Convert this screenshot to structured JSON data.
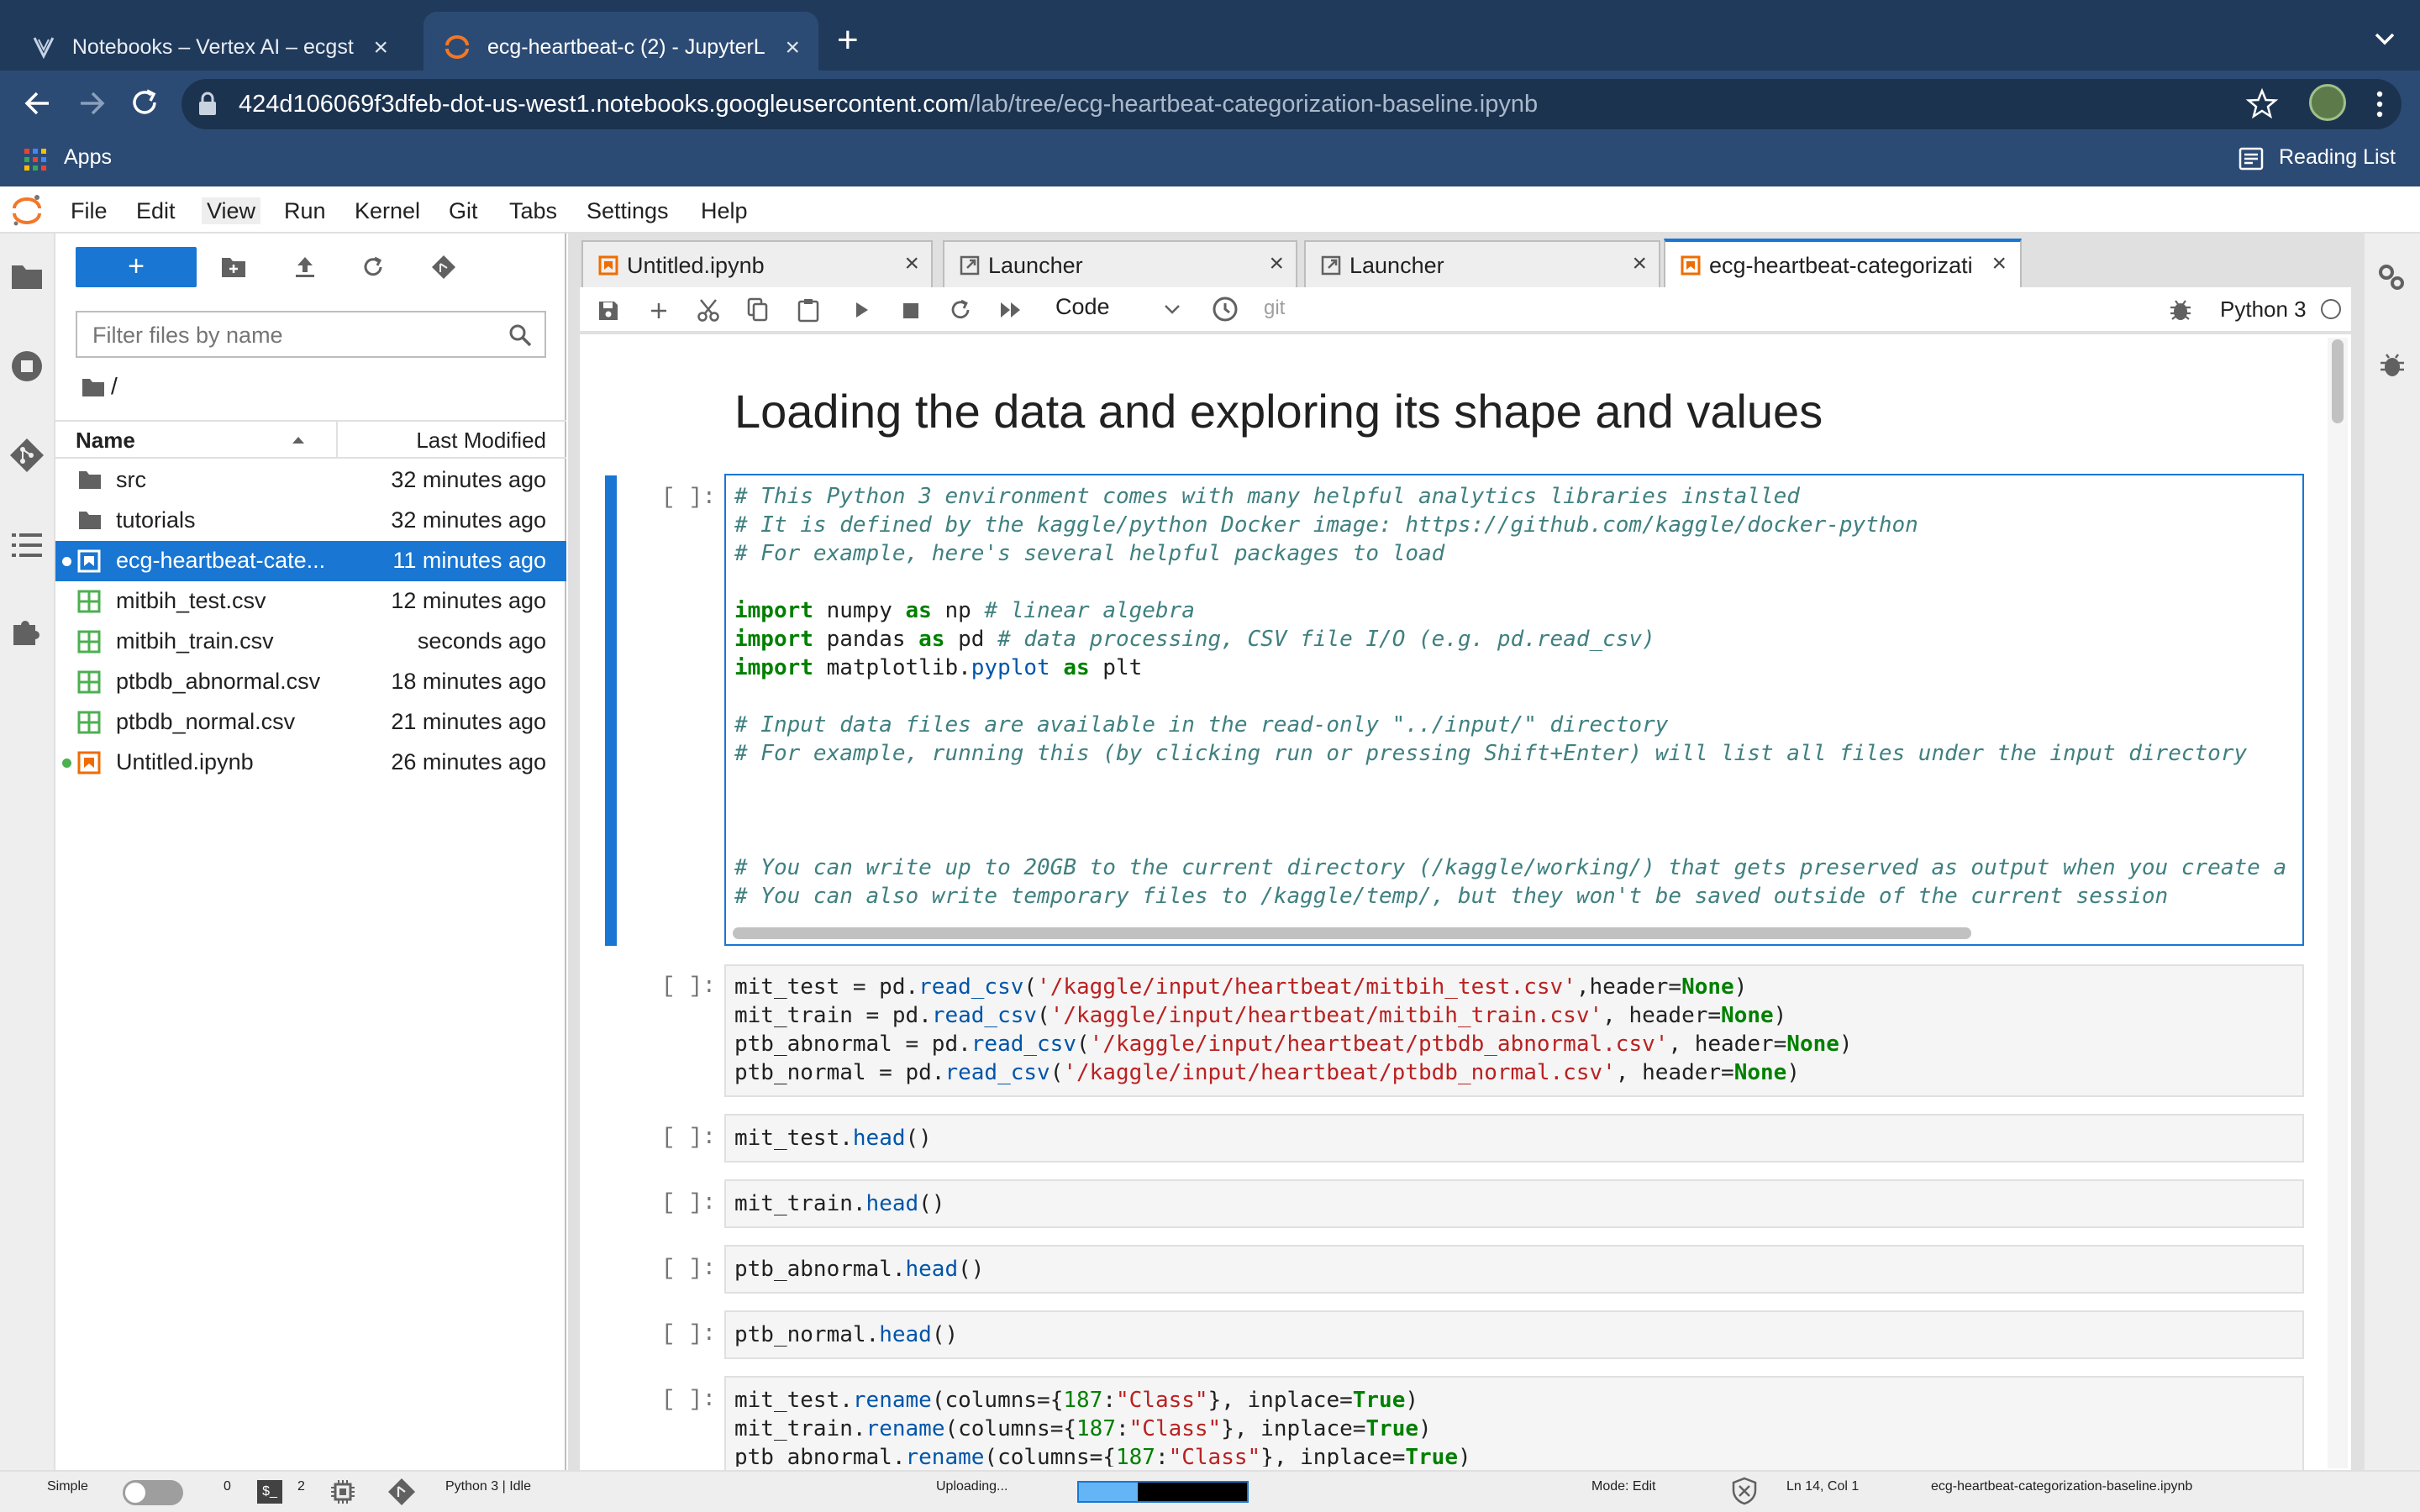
{
  "browser": {
    "tabs": [
      {
        "title": "Notebooks – Vertex AI – ecgst",
        "active": false
      },
      {
        "title": "ecg-heartbeat-c (2) - JupyterL",
        "active": true
      }
    ],
    "url_host": "424d106069f3dfeb-dot-us-west1.notebooks.googleusercontent.com",
    "url_path": "/lab/tree/ecg-heartbeat-categorization-baseline.ipynb",
    "bookmarks": {
      "apps_label": "Apps",
      "reading_list_label": "Reading List"
    }
  },
  "menu": [
    "File",
    "Edit",
    "View",
    "Run",
    "Kernel",
    "Git",
    "Tabs",
    "Settings",
    "Help"
  ],
  "file_browser": {
    "new_button_label": "+",
    "filter_placeholder": "Filter files by name",
    "breadcrumb": "/",
    "header_name": "Name",
    "header_modified": "Last Modified",
    "files": [
      {
        "name": "src",
        "modified": "32 minutes ago",
        "type": "folder",
        "selected": false,
        "running": false
      },
      {
        "name": "tutorials",
        "modified": "32 minutes ago",
        "type": "folder",
        "selected": false,
        "running": false
      },
      {
        "name": "ecg-heartbeat-cate...",
        "modified": "11 minutes ago",
        "type": "notebook",
        "selected": true,
        "running": true
      },
      {
        "name": "mitbih_test.csv",
        "modified": "12 minutes ago",
        "type": "csv",
        "selected": false,
        "running": false
      },
      {
        "name": "mitbih_train.csv",
        "modified": "seconds ago",
        "type": "csv",
        "selected": false,
        "running": false
      },
      {
        "name": "ptbdb_abnormal.csv",
        "modified": "18 minutes ago",
        "type": "csv",
        "selected": false,
        "running": false
      },
      {
        "name": "ptbdb_normal.csv",
        "modified": "21 minutes ago",
        "type": "csv",
        "selected": false,
        "running": false
      },
      {
        "name": "Untitled.ipynb",
        "modified": "26 minutes ago",
        "type": "notebook",
        "selected": false,
        "running": true
      }
    ]
  },
  "doc_tabs": [
    {
      "title": "Untitled.ipynb",
      "type": "notebook",
      "active": false
    },
    {
      "title": "Launcher",
      "type": "launcher",
      "active": false
    },
    {
      "title": "Launcher",
      "type": "launcher",
      "active": false
    },
    {
      "title": "ecg-heartbeat-categorizati",
      "type": "notebook",
      "active": true
    }
  ],
  "notebook_toolbar": {
    "cell_type": "Code",
    "git_label": "git",
    "kernel_name": "Python 3"
  },
  "notebook": {
    "markdown_title": "Loading the data and exploring its shape and values",
    "prompt": "[ ]:"
  },
  "status": {
    "mode_simple": "Simple",
    "terminals": "0",
    "kernels": "2",
    "kernel_status": "Python 3 | Idle",
    "uploading_label": "Uploading...",
    "upload_progress": 0.35,
    "mode": "Mode: Edit",
    "cursor_pos": "Ln 14, Col 1",
    "filename": "ecg-heartbeat-categorization-baseline.ipynb"
  },
  "colors": {
    "accent": "#1976d2",
    "browser_frame": "#203a5c",
    "browser_toolbar": "#2c4b74"
  }
}
